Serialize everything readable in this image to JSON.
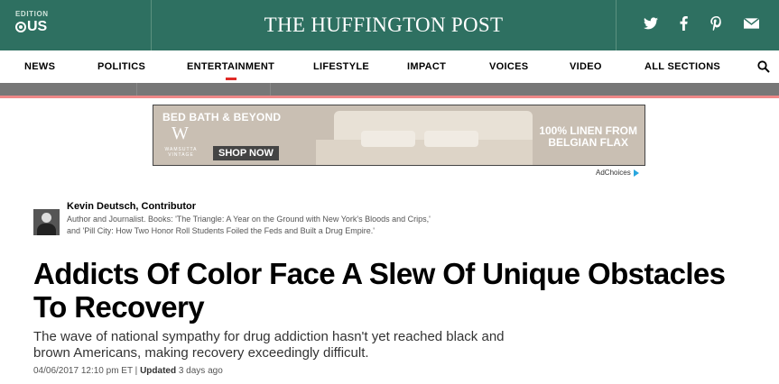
{
  "header": {
    "edition_label": "EDITION",
    "edition_value": "US",
    "masthead": "THE HUFFINGTON POST",
    "social": [
      {
        "icon": "twitter-icon",
        "glyph": "🐦"
      },
      {
        "icon": "facebook-icon",
        "glyph": "f"
      },
      {
        "icon": "pinterest-icon",
        "glyph": "P"
      },
      {
        "icon": "email-icon",
        "glyph": "✉"
      }
    ],
    "bg_color": "#2e7061"
  },
  "nav": {
    "items": [
      "NEWS",
      "POLITICS",
      "ENTERTAINMENT",
      "LIFESTYLE",
      "IMPACT",
      "VOICES",
      "VIDEO",
      "ALL SECTIONS"
    ],
    "active": "ENTERTAINMENT",
    "accent_color": "#e02a27"
  },
  "ad": {
    "brand": "BED BATH & BEYOND",
    "sub_brand": "W",
    "sub_brand_caption": "WAMSUTTA VINTAGE",
    "cta": "SHOP NOW",
    "copy": "100% LINEN FROM\nBELGIAN FLAX",
    "adchoices": "AdChoices"
  },
  "author": {
    "name": "Kevin Deutsch, Contributor",
    "bio": "Author and Journalist. Books: 'The Triangle: A Year on the Ground with New York's Bloods and Crips,' and 'Pill City: How Two Honor Roll Students Foiled the Feds and Built a Drug Empire.'"
  },
  "article": {
    "headline": "Addicts Of Color Face A Slew Of Unique Obstacles To Recovery",
    "dek": "The wave of national sympathy for drug addiction hasn't yet reached black and brown Americans, making recovery exceedingly difficult.",
    "published": "04/06/2017 12:10 pm ET",
    "separator": " | ",
    "updated_label": "Updated",
    "updated_value": " 3 days ago"
  }
}
